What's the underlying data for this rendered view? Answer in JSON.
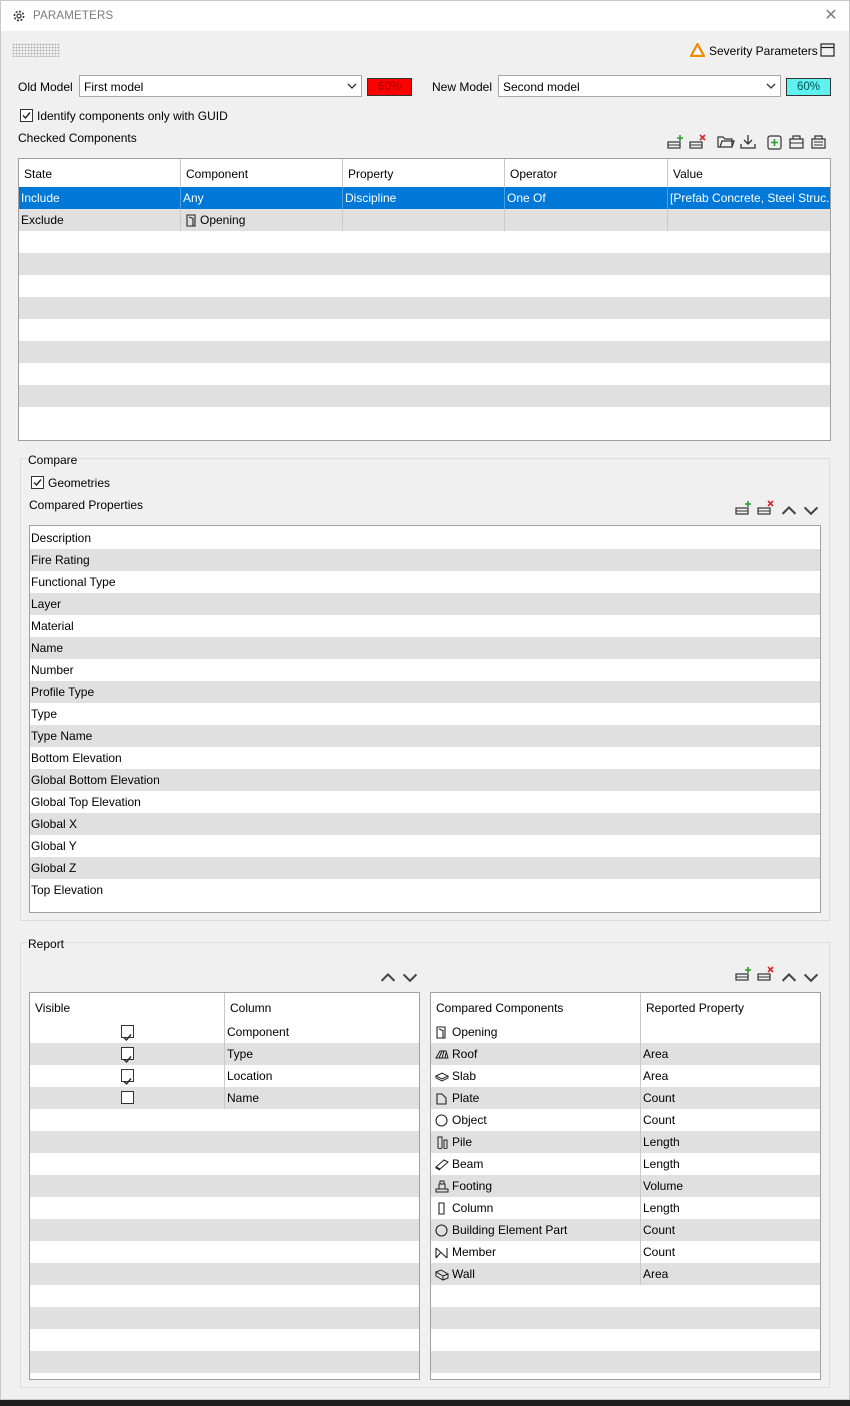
{
  "window": {
    "title": "PARAMETERS"
  },
  "toolbar": {
    "severity_label": "Severity Parameters"
  },
  "models": {
    "old_label": "Old Model",
    "old_value": "First model",
    "old_pct": "60%",
    "old_color": "#ff0000",
    "new_label": "New Model",
    "new_value": "Second model",
    "new_pct": "60%",
    "new_color": "#5ff0f0"
  },
  "guid_checkbox": {
    "label": "Identify components only with GUID",
    "checked": true
  },
  "checked_components": {
    "title": "Checked Components",
    "columns": [
      "State",
      "Component",
      "Property",
      "Operator",
      "Value"
    ],
    "rows": [
      {
        "state": "Include",
        "component": "Any",
        "property": "Discipline",
        "operator": "One Of",
        "value": "[Prefab Concrete, Steel Struc...",
        "selected": true
      },
      {
        "state": "Exclude",
        "component": "Opening",
        "property": "",
        "operator": "",
        "value": "",
        "selected": false
      }
    ]
  },
  "compare": {
    "title": "Compare",
    "geometries_label": "Geometries",
    "geometries_checked": true,
    "properties_title": "Compared Properties",
    "properties": [
      "Description",
      "Fire Rating",
      "Functional Type",
      "Layer",
      "Material",
      "Name",
      "Number",
      "Profile Type",
      "Type",
      "Type Name",
      "Bottom Elevation",
      "Global Bottom Elevation",
      "Global Top Elevation",
      "Global X",
      "Global Y",
      "Global Z",
      "Top Elevation"
    ]
  },
  "report": {
    "title": "Report",
    "left_columns": [
      "Visible",
      "Column"
    ],
    "left_rows": [
      {
        "visible": true,
        "column": "Component"
      },
      {
        "visible": true,
        "column": "Type"
      },
      {
        "visible": true,
        "column": "Location"
      },
      {
        "visible": false,
        "column": "Name"
      }
    ],
    "right_columns": [
      "Compared Components",
      "Reported Property"
    ],
    "right_rows": [
      {
        "icon": "opening-icon",
        "component": "Opening",
        "property": ""
      },
      {
        "icon": "roof-icon",
        "component": "Roof",
        "property": "Area"
      },
      {
        "icon": "slab-icon",
        "component": "Slab",
        "property": "Area"
      },
      {
        "icon": "plate-icon",
        "component": "Plate",
        "property": "Count"
      },
      {
        "icon": "object-icon",
        "component": "Object",
        "property": "Count"
      },
      {
        "icon": "pile-icon",
        "component": "Pile",
        "property": "Length"
      },
      {
        "icon": "beam-icon",
        "component": "Beam",
        "property": "Length"
      },
      {
        "icon": "footing-icon",
        "component": "Footing",
        "property": "Volume"
      },
      {
        "icon": "column-icon",
        "component": "Column",
        "property": "Length"
      },
      {
        "icon": "building-element-part-icon",
        "component": "Building Element Part",
        "property": "Count"
      },
      {
        "icon": "member-icon",
        "component": "Member",
        "property": "Count"
      },
      {
        "icon": "wall-icon",
        "component": "Wall",
        "property": "Area"
      }
    ]
  }
}
